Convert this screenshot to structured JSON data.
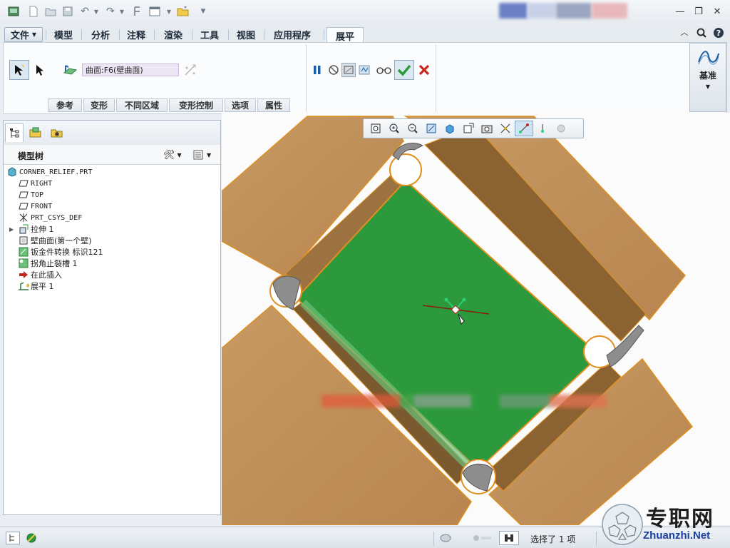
{
  "quickbar": {
    "icons": [
      "app-icon",
      "new-icon",
      "open-icon",
      "save-icon",
      "undo-icon",
      "redo-icon",
      "regenerate-icon",
      "windows-icon",
      "folder-icon",
      "customize-icon"
    ]
  },
  "tabs": {
    "file": "文件",
    "items": [
      "模型",
      "分析",
      "注释",
      "渲染",
      "工具",
      "视图",
      "应用程序"
    ],
    "active": "展平"
  },
  "ribbon": {
    "surface_field": "曲面:F6(壁曲面)",
    "subtabs": [
      "参考",
      "变形",
      "不同区域",
      "变形控制",
      "选项",
      "属性"
    ],
    "datum_label": "基准"
  },
  "tree": {
    "title": "模型树",
    "items": [
      {
        "label": "CORNER_RELIEF.PRT",
        "icon": "part-icon",
        "mono": true
      },
      {
        "label": "RIGHT",
        "icon": "datum-plane-icon",
        "mono": true
      },
      {
        "label": "TOP",
        "icon": "datum-plane-icon",
        "mono": true
      },
      {
        "label": "FRONT",
        "icon": "datum-plane-icon",
        "mono": true
      },
      {
        "label": "PRT_CSYS_DEF",
        "icon": "csys-icon",
        "mono": true
      },
      {
        "label": "拉伸 1",
        "icon": "extrude-icon",
        "mono": false,
        "expand": true
      },
      {
        "label": "壁曲面(第一个壁)",
        "icon": "wall-surface-icon",
        "mono": false
      },
      {
        "label": "钣金件转换 标识121",
        "icon": "sheetmetal-convert-icon",
        "mono": false
      },
      {
        "label": "拐角止裂槽 1",
        "icon": "corner-relief-icon",
        "mono": false
      },
      {
        "label": "在此插入",
        "icon": "insert-here-icon",
        "mono": false
      },
      {
        "label": "展平 1",
        "icon": "flatten-icon",
        "mono": false
      }
    ]
  },
  "status": {
    "selection": "选择了 1 项"
  },
  "watermark": {
    "cn": "专职网",
    "en": "Zhuanzhi.Net"
  },
  "colors": {
    "accent_blue": "#1a5ea8",
    "confirm_green": "#2a9d3a",
    "cancel_red": "#c8241e",
    "model_green": "#2c9a3c",
    "model_tan": "#c9995f"
  }
}
